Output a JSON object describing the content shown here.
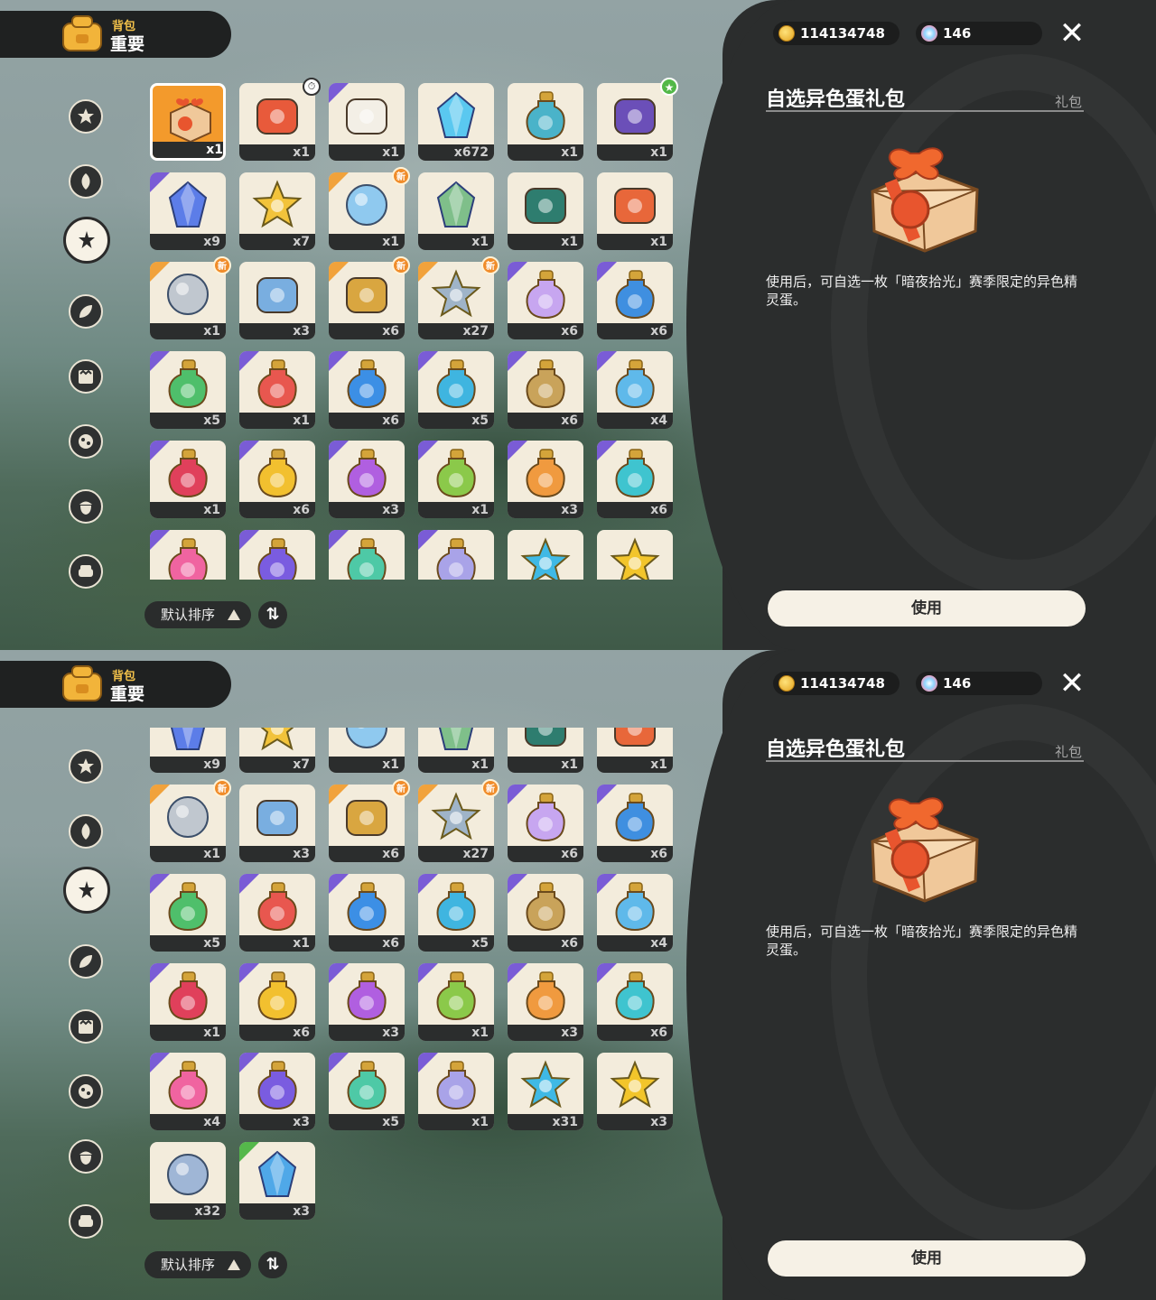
{
  "header": {
    "subtitle": "背包",
    "title": "重要"
  },
  "currency": {
    "coins": "114134748",
    "gems": "146"
  },
  "detail": {
    "name": "自选异色蛋礼包",
    "type": "礼包",
    "description": "使用后，可自选一枚「暗夜拾光」赛季限定的异色精灵蛋。",
    "use_label": "使用"
  },
  "sort": {
    "label": "默认排序"
  },
  "categories": [
    {
      "icon": "star-medal-icon"
    },
    {
      "icon": "leaf-flame-icon"
    },
    {
      "icon": "sparkle-star-icon",
      "active": true
    },
    {
      "icon": "leaves-icon"
    },
    {
      "icon": "crown-scroll-icon"
    },
    {
      "icon": "moon-stars-icon"
    },
    {
      "icon": "acorn-icon"
    },
    {
      "icon": "sofa-icon"
    }
  ],
  "screen1_items": [
    {
      "name": "gift-box",
      "count": "x1",
      "corner": "",
      "badge": "",
      "color": "#f2a03c",
      "selected": true
    },
    {
      "name": "ticket",
      "count": "x1",
      "corner": "",
      "badge": "clock",
      "color": "#e85a3b"
    },
    {
      "name": "letter-card",
      "count": "x1",
      "corner": "purple",
      "badge": "",
      "color": "#f3efe6"
    },
    {
      "name": "prism-crystal",
      "count": "x672",
      "corner": "",
      "badge": "",
      "color": "#5ac8f0"
    },
    {
      "name": "blue-bottle",
      "count": "x1",
      "corner": "",
      "badge": "",
      "color": "#4ab3c9"
    },
    {
      "name": "purple-pouch",
      "count": "x1",
      "corner": "",
      "badge": "green",
      "color": "#6b4fb8"
    },
    {
      "name": "blue-crystal",
      "count": "x9",
      "corner": "purple",
      "badge": "",
      "color": "#5c7de8"
    },
    {
      "name": "gold-star",
      "count": "x7",
      "corner": "",
      "badge": "",
      "color": "#f2c33b"
    },
    {
      "name": "orb-keychain",
      "count": "x1",
      "corner": "orange",
      "badge": "new",
      "color": "#8fc9ef"
    },
    {
      "name": "crystal-crown",
      "count": "x1",
      "corner": "",
      "badge": "",
      "color": "#7fbf8a"
    },
    {
      "name": "feather-leaf",
      "count": "x1",
      "corner": "",
      "badge": "",
      "color": "#2e7d6f"
    },
    {
      "name": "flame-flower",
      "count": "x1",
      "corner": "",
      "badge": "",
      "color": "#e8673a"
    },
    {
      "name": "silver-keychain",
      "count": "x1",
      "corner": "orange",
      "badge": "new",
      "color": "#c0c7cf"
    },
    {
      "name": "blue-stone",
      "count": "x3",
      "corner": "",
      "badge": "",
      "color": "#79aee0"
    },
    {
      "name": "gold-key",
      "count": "x6",
      "corner": "orange",
      "badge": "new",
      "color": "#d9a640"
    },
    {
      "name": "star-wand",
      "count": "x27",
      "corner": "orange",
      "badge": "new",
      "color": "#9fb4c8"
    },
    {
      "name": "rainbow-bottle",
      "count": "x6",
      "corner": "purple",
      "badge": "",
      "color": "#c7a6f0"
    },
    {
      "name": "blue-potion",
      "count": "x6",
      "corner": "purple",
      "badge": "",
      "color": "#3f8fe0"
    },
    {
      "name": "green-potion",
      "count": "x5",
      "corner": "purple",
      "badge": "",
      "color": "#4fbf6b"
    },
    {
      "name": "red-potion",
      "count": "x1",
      "corner": "purple",
      "badge": "",
      "color": "#e8574f"
    },
    {
      "name": "azure-potion",
      "count": "x6",
      "corner": "purple",
      "badge": "",
      "color": "#3c8fe5"
    },
    {
      "name": "cyan-potion",
      "count": "x5",
      "corner": "purple",
      "badge": "",
      "color": "#3fb5e0"
    },
    {
      "name": "tan-potion",
      "count": "x6",
      "corner": "purple",
      "badge": "",
      "color": "#c9a35a"
    },
    {
      "name": "sky-potion",
      "count": "x4",
      "corner": "purple",
      "badge": "",
      "color": "#5fb9ea"
    },
    {
      "name": "crimson-potion",
      "count": "x1",
      "corner": "purple",
      "badge": "",
      "color": "#e0405b"
    },
    {
      "name": "yellow-potion",
      "count": "x6",
      "corner": "purple",
      "badge": "",
      "color": "#f2c02f"
    },
    {
      "name": "violet-potion",
      "count": "x3",
      "corner": "purple",
      "badge": "",
      "color": "#b05fe0"
    },
    {
      "name": "lime-potion",
      "count": "x1",
      "corner": "purple",
      "badge": "",
      "color": "#8bc94a"
    },
    {
      "name": "orange-potion",
      "count": "x3",
      "corner": "purple",
      "badge": "",
      "color": "#f09a3f"
    },
    {
      "name": "teal-potion",
      "count": "x6",
      "corner": "purple",
      "badge": "",
      "color": "#3fc4cf"
    },
    {
      "name": "pink-potion",
      "count": "",
      "corner": "purple",
      "badge": "",
      "color": "#f064a0"
    },
    {
      "name": "indigo-potion",
      "count": "",
      "corner": "purple",
      "badge": "",
      "color": "#7a5ce0"
    },
    {
      "name": "mint-potion",
      "count": "",
      "corner": "purple",
      "badge": "",
      "color": "#4ec9a6"
    },
    {
      "name": "lavender-potion",
      "count": "",
      "corner": "purple",
      "badge": "",
      "color": "#a9a3e8"
    },
    {
      "name": "blue-star",
      "count": "",
      "corner": "",
      "badge": "",
      "color": "#3fb9e5"
    },
    {
      "name": "yellow-star",
      "count": "",
      "corner": "",
      "badge": "",
      "color": "#f2c52b"
    }
  ],
  "screen2_items": [
    {
      "name": "blue-crystal",
      "count": "x9",
      "corner": "purple",
      "badge": "",
      "color": "#5c7de8"
    },
    {
      "name": "gold-star",
      "count": "x7",
      "corner": "",
      "badge": "",
      "color": "#f2c33b"
    },
    {
      "name": "orb-keychain",
      "count": "x1",
      "corner": "orange",
      "badge": "",
      "color": "#8fc9ef"
    },
    {
      "name": "crystal-crown",
      "count": "x1",
      "corner": "",
      "badge": "",
      "color": "#7fbf8a"
    },
    {
      "name": "feather-leaf",
      "count": "x1",
      "corner": "",
      "badge": "",
      "color": "#2e7d6f"
    },
    {
      "name": "flame-flower",
      "count": "x1",
      "corner": "",
      "badge": "",
      "color": "#e8673a"
    },
    {
      "name": "silver-keychain",
      "count": "x1",
      "corner": "orange",
      "badge": "new",
      "color": "#c0c7cf"
    },
    {
      "name": "blue-stone",
      "count": "x3",
      "corner": "",
      "badge": "",
      "color": "#79aee0"
    },
    {
      "name": "gold-key",
      "count": "x6",
      "corner": "orange",
      "badge": "new",
      "color": "#d9a640"
    },
    {
      "name": "star-wand",
      "count": "x27",
      "corner": "orange",
      "badge": "new",
      "color": "#9fb4c8"
    },
    {
      "name": "rainbow-bottle",
      "count": "x6",
      "corner": "purple",
      "badge": "",
      "color": "#c7a6f0"
    },
    {
      "name": "blue-potion",
      "count": "x6",
      "corner": "purple",
      "badge": "",
      "color": "#3f8fe0"
    },
    {
      "name": "green-potion",
      "count": "x5",
      "corner": "purple",
      "badge": "",
      "color": "#4fbf6b"
    },
    {
      "name": "red-potion",
      "count": "x1",
      "corner": "purple",
      "badge": "",
      "color": "#e8574f"
    },
    {
      "name": "azure-potion",
      "count": "x6",
      "corner": "purple",
      "badge": "",
      "color": "#3c8fe5"
    },
    {
      "name": "cyan-potion",
      "count": "x5",
      "corner": "purple",
      "badge": "",
      "color": "#3fb5e0"
    },
    {
      "name": "tan-potion",
      "count": "x6",
      "corner": "purple",
      "badge": "",
      "color": "#c9a35a"
    },
    {
      "name": "sky-potion",
      "count": "x4",
      "corner": "purple",
      "badge": "",
      "color": "#5fb9ea"
    },
    {
      "name": "crimson-potion",
      "count": "x1",
      "corner": "purple",
      "badge": "",
      "color": "#e0405b"
    },
    {
      "name": "yellow-potion",
      "count": "x6",
      "corner": "purple",
      "badge": "",
      "color": "#f2c02f"
    },
    {
      "name": "violet-potion",
      "count": "x3",
      "corner": "purple",
      "badge": "",
      "color": "#b05fe0"
    },
    {
      "name": "lime-potion",
      "count": "x1",
      "corner": "purple",
      "badge": "",
      "color": "#8bc94a"
    },
    {
      "name": "orange-potion",
      "count": "x3",
      "corner": "purple",
      "badge": "",
      "color": "#f09a3f"
    },
    {
      "name": "teal-potion",
      "count": "x6",
      "corner": "purple",
      "badge": "",
      "color": "#3fc4cf"
    },
    {
      "name": "pink-potion",
      "count": "x4",
      "corner": "purple",
      "badge": "",
      "color": "#f064a0"
    },
    {
      "name": "indigo-potion",
      "count": "x3",
      "corner": "purple",
      "badge": "",
      "color": "#7a5ce0"
    },
    {
      "name": "mint-potion",
      "count": "x5",
      "corner": "purple",
      "badge": "",
      "color": "#4ec9a6"
    },
    {
      "name": "lavender-potion",
      "count": "x1",
      "corner": "purple",
      "badge": "",
      "color": "#a9a3e8"
    },
    {
      "name": "blue-star",
      "count": "x31",
      "corner": "",
      "badge": "",
      "color": "#3fb9e5"
    },
    {
      "name": "yellow-star",
      "count": "x3",
      "corner": "",
      "badge": "",
      "color": "#f2c52b"
    },
    {
      "name": "silver-coin",
      "count": "x32",
      "corner": "",
      "badge": "",
      "color": "#9fb6d6"
    },
    {
      "name": "crystal-ball",
      "count": "x3",
      "corner": "green",
      "badge": "",
      "color": "#4fa8e8"
    }
  ],
  "badges": {
    "new": "新"
  }
}
